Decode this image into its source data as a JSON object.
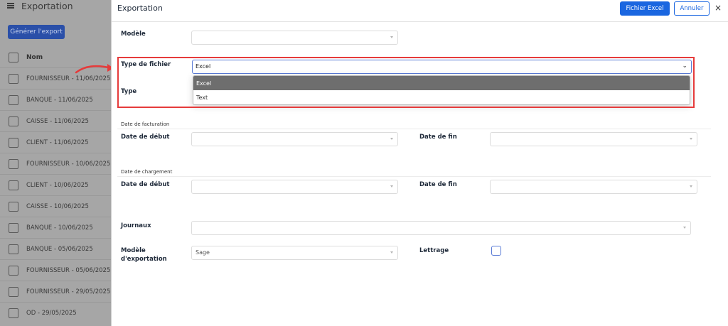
{
  "background": {
    "title": "Exportation",
    "generate_button": "Générer l'export",
    "column_header": "Nom",
    "rows": [
      "FOURNISSEUR - 11/06/2025",
      "BANQUE - 11/06/2025",
      "CAISSE - 11/06/2025",
      "CLIENT - 11/06/2025",
      "FOURNISSEUR - 10/06/2025",
      "CLIENT - 10/06/2025",
      "CAISSE - 10/06/2025",
      "BANQUE - 10/06/2025",
      "BANQUE - 05/06/2025",
      "FOURNISSEUR - 05/06/2025",
      "FOURNISSEUR - 29/05/2025",
      "OD - 29/05/2025"
    ]
  },
  "modal": {
    "title": "Exportation",
    "excel_button": "Fichier Excel",
    "cancel_button": "Annuler",
    "close_glyph": "×",
    "modele_label": "Modèle",
    "type_fichier_label": "Type de fichier",
    "type_fichier_value": "Excel",
    "type_fichier_options": [
      "Excel",
      "Text"
    ],
    "type_label": "Type",
    "facturation_section": "Date de facturation",
    "chargement_section": "Date de chargement",
    "date_debut_label": "Date de début",
    "date_fin_label": "Date de fin",
    "journaux_label": "Journaux",
    "modele_export_label_1": "Modèle",
    "modele_export_label_2": "d'exportation",
    "modele_export_value": "Sage",
    "lettrage_label": "Lettrage"
  },
  "colors": {
    "primary": "#1a66e0",
    "highlight_border": "#e63b3b",
    "selected_option": "#6e6e6e",
    "overlay": "#a6a6a6"
  }
}
